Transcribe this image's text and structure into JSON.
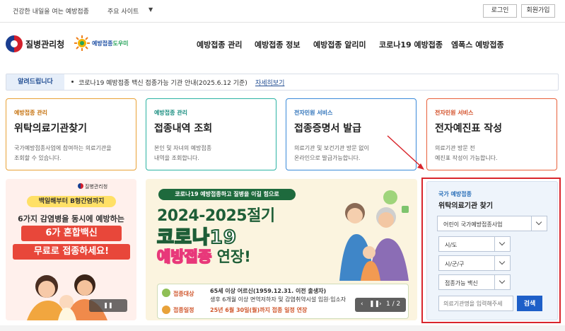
{
  "util": {
    "slogan": "건강한 내일을 여는 예방접종",
    "sites": "주요 사이트",
    "login": "로그인",
    "join": "회원가입"
  },
  "header": {
    "agency": "질병관리청",
    "helper_a": "예방접종",
    "helper_b": "도우미",
    "nav": [
      "예방접종 관리",
      "예방접종 정보",
      "예방접종 알리미",
      "코로나19 예방접종",
      "엠폭스 예방접종"
    ]
  },
  "notice": {
    "tag": "알려드립니다",
    "text": "코로나19 예방접종 백신 접종가능 기관 안내(2025.6.12 기준)",
    "more": "자세히보기"
  },
  "cards": [
    {
      "cat": "예방접종 관리",
      "title": "위탁의료기관찾기",
      "d1": "국가예방접종사업에 참여하는 의료기관을",
      "d2": "조회할 수 있습니다."
    },
    {
      "cat": "예방접종 관리",
      "title": "접종내역 조회",
      "d1": "본인 및 자녀의 예방접종",
      "d2": "내역을 조회합니다."
    },
    {
      "cat": "전자민원 서비스",
      "title": "접종증명서 발급",
      "d1": "의료기관 및 보건기관 방문 없이",
      "d2": "온라인으로 발급가능합니다."
    },
    {
      "cat": "전자민원 서비스",
      "title": "전자예진표 작성",
      "d1": "의료기관 방문 전",
      "d2": "예진표 작성이 가능합니다."
    }
  ],
  "banner1": {
    "logo": "질병관리청",
    "pill": "백일해부터 B형간염까지",
    "line1": "6가지 감염병을 동시에 예방하는",
    "box1": "6가 혼합백신",
    "box2": "무료로 접종하세요!"
  },
  "banner2": {
    "top": "코로나19 예방접종하고 질병을 이길 힘으로",
    "years": "2024-2025절기",
    "covid": "코로나19",
    "ext_a": "예방접종",
    "ext_b": " 연장!",
    "label1": "접종대상",
    "target1": "65세 이상 어르신(1959.12.31. 이전 출생자)",
    "target2": "생후 6개월 이상 면역저하자 및 감염취약시설 입원·입소자",
    "label2": "접종일정",
    "schedule": "25년 6월 30일(월)까지 접종 일정 연장",
    "pager": "1 / 2"
  },
  "panel": {
    "cat": "국가 예방접종",
    "title": "위탁의료기관 찾기",
    "type": "어린이 국가예방접종사업",
    "s1": "시/도",
    "s2": "시/군/구",
    "s3": "접종가능 백신",
    "placeholder": "의료기관명을 입력해주세",
    "search": "검색"
  },
  "colors": {
    "highlight": "#d9262c",
    "search_button": "#1e5fc8",
    "notice_tag": "#1f4b91"
  }
}
